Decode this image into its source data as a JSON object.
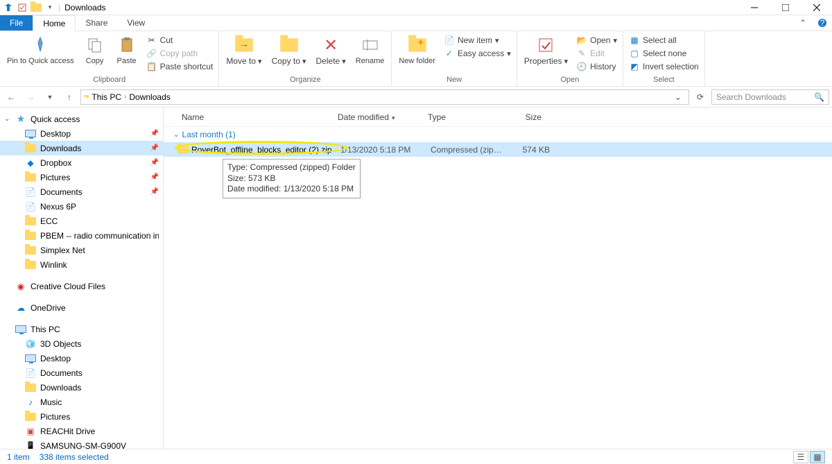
{
  "title": "Downloads",
  "tabs": {
    "file": "File",
    "home": "Home",
    "share": "Share",
    "view": "View"
  },
  "ribbon": {
    "clipboard": {
      "label": "Clipboard",
      "pin": "Pin to Quick access",
      "copy": "Copy",
      "paste": "Paste",
      "cut": "Cut",
      "copypath": "Copy path",
      "pasteshortcut": "Paste shortcut"
    },
    "organize": {
      "label": "Organize",
      "moveto": "Move to",
      "copyto": "Copy to",
      "delete": "Delete",
      "rename": "Rename"
    },
    "new": {
      "label": "New",
      "newfolder": "New folder",
      "newitem": "New item",
      "easyaccess": "Easy access"
    },
    "open": {
      "label": "Open",
      "properties": "Properties",
      "open": "Open",
      "edit": "Edit",
      "history": "History"
    },
    "select": {
      "label": "Select",
      "selectall": "Select all",
      "selectnone": "Select none",
      "invert": "Invert selection"
    }
  },
  "breadcrumb": {
    "root": "This PC",
    "folder": "Downloads"
  },
  "search": {
    "placeholder": "Search Downloads"
  },
  "nav": {
    "quickaccess": "Quick access",
    "items1": [
      "Desktop",
      "Downloads",
      "Dropbox",
      "Pictures",
      "Documents",
      "Nexus 6P",
      "ECC",
      "PBEM -- radio communication integrati",
      "Simplex Net",
      "Winlink"
    ],
    "ccf": "Creative Cloud Files",
    "onedrive": "OneDrive",
    "thispc": "This PC",
    "pcitems": [
      "3D Objects",
      "Desktop",
      "Documents",
      "Downloads",
      "Music",
      "Pictures",
      "REACHit Drive",
      "SAMSUNG-SM-G900V"
    ]
  },
  "columns": {
    "name": "Name",
    "date": "Date modified",
    "type": "Type",
    "size": "Size"
  },
  "group": "Last month (1)",
  "file": {
    "name": "RoverBot_offline_blocks_editor (2).zip",
    "date": "1/13/2020 5:18 PM",
    "type": "Compressed (zipp...",
    "size": "574 KB"
  },
  "tooltip": {
    "l1": "Type: Compressed (zipped) Folder",
    "l2": "Size: 573 KB",
    "l3": "Date modified: 1/13/2020 5:18 PM"
  },
  "status": {
    "items": "1 item",
    "selected": "338 items selected"
  }
}
